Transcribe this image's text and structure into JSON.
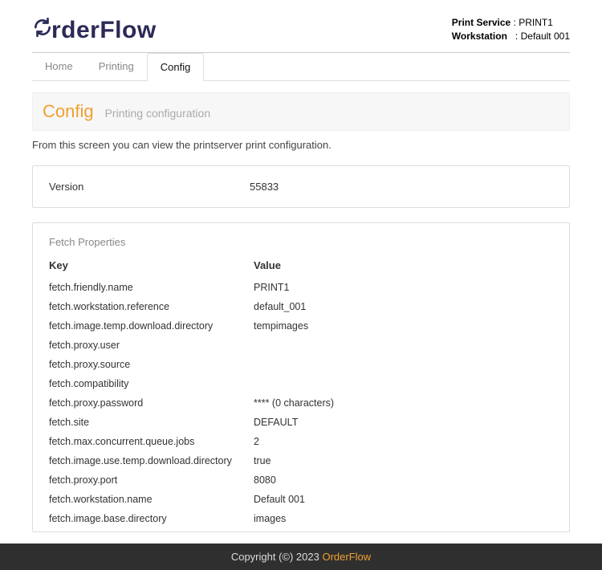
{
  "header": {
    "logo_text": "OrderFlow",
    "print_service_label": "Print Service",
    "print_service_value": "PRINT1",
    "workstation_label": "Workstation",
    "workstation_value": "Default 001"
  },
  "tabs": {
    "home": "Home",
    "printing": "Printing",
    "config": "Config"
  },
  "title": {
    "main": "Config",
    "sub": "Printing configuration"
  },
  "intro": "From this screen you can view the printserver print configuration.",
  "version": {
    "label": "Version",
    "value": "55833"
  },
  "fetch": {
    "section": "Fetch Properties",
    "key_header": "Key",
    "value_header": "Value",
    "items": [
      {
        "k": "fetch.friendly.name",
        "v": "PRINT1"
      },
      {
        "k": "fetch.workstation.reference",
        "v": "default_001"
      },
      {
        "k": "fetch.image.temp.download.directory",
        "v": "tempimages"
      },
      {
        "k": "fetch.proxy.user",
        "v": ""
      },
      {
        "k": "fetch.proxy.source",
        "v": ""
      },
      {
        "k": "fetch.compatibility",
        "v": ""
      },
      {
        "k": "fetch.proxy.password",
        "v": "**** (0 characters)"
      },
      {
        "k": "fetch.site",
        "v": "DEFAULT"
      },
      {
        "k": "fetch.max.concurrent.queue.jobs",
        "v": "2"
      },
      {
        "k": "fetch.image.use.temp.download.directory",
        "v": "true"
      },
      {
        "k": "fetch.proxy.port",
        "v": "8080"
      },
      {
        "k": "fetch.workstation.name",
        "v": "Default 001"
      },
      {
        "k": "fetch.image.base.directory",
        "v": "images"
      }
    ]
  },
  "footer": {
    "text_prefix": "Copyright (©) 2023 ",
    "brand": "OrderFlow"
  }
}
